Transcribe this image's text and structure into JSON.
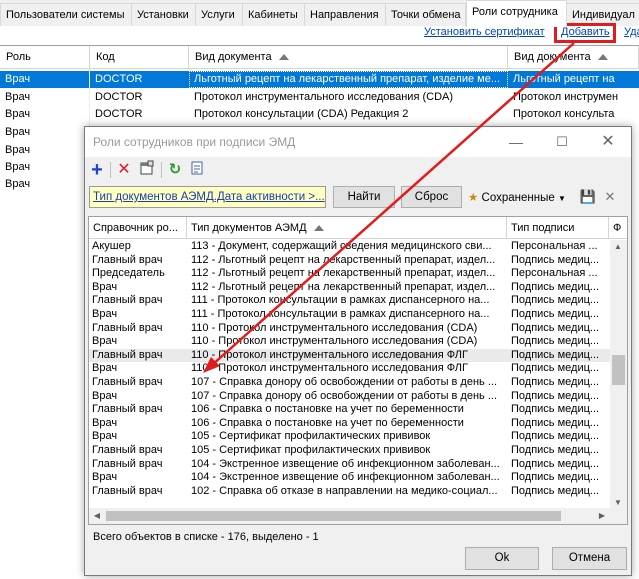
{
  "tabs": [
    "Пользователи системы",
    "Установки",
    "Услуги",
    "Кабинеты",
    "Направления",
    "Точки обмена",
    "Роли сотрудника",
    "Индивидуал"
  ],
  "active_tab": "Роли сотрудника",
  "links": {
    "set_certificate": "Установить сертификат",
    "add": "Добавить",
    "delete": "Уда"
  },
  "main_grid": {
    "columns": [
      "Роль",
      "Код",
      "Вид документа",
      "Вид документа"
    ],
    "rows": [
      [
        "Врач",
        "DOCTOR",
        "Льготный рецепт на лекарственный препарат, изделие ме...",
        "Льготный рецепт на"
      ],
      [
        "Врач",
        "DOCTOR",
        "Протокол инструментального исследования (CDA)",
        "Протокол инструмен"
      ],
      [
        "Врач",
        "DOCTOR",
        "Протокол консультации (CDA) Редакция 2",
        "Протокол консульта"
      ],
      [
        "Врач",
        "",
        "",
        ""
      ],
      [
        "Врач",
        "",
        "",
        ""
      ],
      [
        "Врач",
        "",
        "",
        ""
      ],
      [
        "Врач",
        "",
        "",
        ""
      ]
    ]
  },
  "dialog": {
    "title": "Роли сотрудников при подписи ЭМД",
    "filter_text": "Тип документов АЭМД.Дата активности >...",
    "find_button": "Найти",
    "reset_button": "Сброс",
    "saved_label": "Сохраненные",
    "columns": [
      "Справочник ро...",
      "Тип документов АЭМД",
      "Тип подписи",
      "Ф"
    ],
    "rows": [
      [
        "Акушер",
        "113 - Документ, содержащий сведения медицинского сви...",
        "Персональная ..."
      ],
      [
        "Главный врач",
        "112 - Льготный рецепт на лекарственный препарат, издел...",
        "Подпись медиц..."
      ],
      [
        "Председатель",
        "112 - Льготный рецепт на лекарственный препарат, издел...",
        "Персональная ..."
      ],
      [
        "Врач",
        "112 - Льготный рецепт на лекарственный препарат, издел...",
        "Подпись медиц..."
      ],
      [
        "Главный врач",
        "111 - Протокол консультации в рамках диспансерного на...",
        "Подпись медиц..."
      ],
      [
        "Врач",
        "111 - Протокол консультации в рамках диспансерного на...",
        "Подпись медиц..."
      ],
      [
        "Главный врач",
        "110 - Протокол инструментального исследования (CDA)",
        "Подпись медиц..."
      ],
      [
        "Врач",
        "110 - Протокол инструментального исследования (CDA)",
        "Подпись медиц..."
      ],
      [
        "Главный врач",
        "110 - Протокол инструментального исследования ФЛГ",
        "Подпись медиц..."
      ],
      [
        "Врач",
        "110 - Протокол инструментального исследования ФЛГ",
        "Подпись медиц..."
      ],
      [
        "Главный врач",
        "107 - Справка донору об освобождении от работы в день ...",
        "Подпись медиц..."
      ],
      [
        "Врач",
        "107 - Справка донору об освобождении от работы в день ...",
        "Подпись медиц..."
      ],
      [
        "Главный врач",
        "106 - Справка о постановке на учет по беременности",
        "Подпись медиц..."
      ],
      [
        "Врач",
        "106 - Справка о постановке на учет по беременности",
        "Подпись медиц..."
      ],
      [
        "Врач",
        "105 - Сертификат профилактических прививок",
        "Подпись медиц..."
      ],
      [
        "Главный врач",
        "105 - Сертификат профилактических прививок",
        "Подпись медиц..."
      ],
      [
        "Главный врач",
        "104 - Экстренное извещение об инфекционном заболеван...",
        "Подпись медиц..."
      ],
      [
        "Врач",
        "104 - Экстренное извещение об инфекционном заболеван...",
        "Подпись медиц..."
      ],
      [
        "Главный врач",
        "102 - Справка об отказе в направлении на медико-социал...",
        "Подпись медиц..."
      ]
    ],
    "status": "Всего объектов в списке - 176, выделено - 1",
    "ok_button": "Ok",
    "cancel_button": "Отмена"
  },
  "colors": {
    "selection": "#0078d7",
    "link": "#0044bb",
    "highlight": "#e21c1c",
    "filter_bg": "#ffffc0"
  }
}
